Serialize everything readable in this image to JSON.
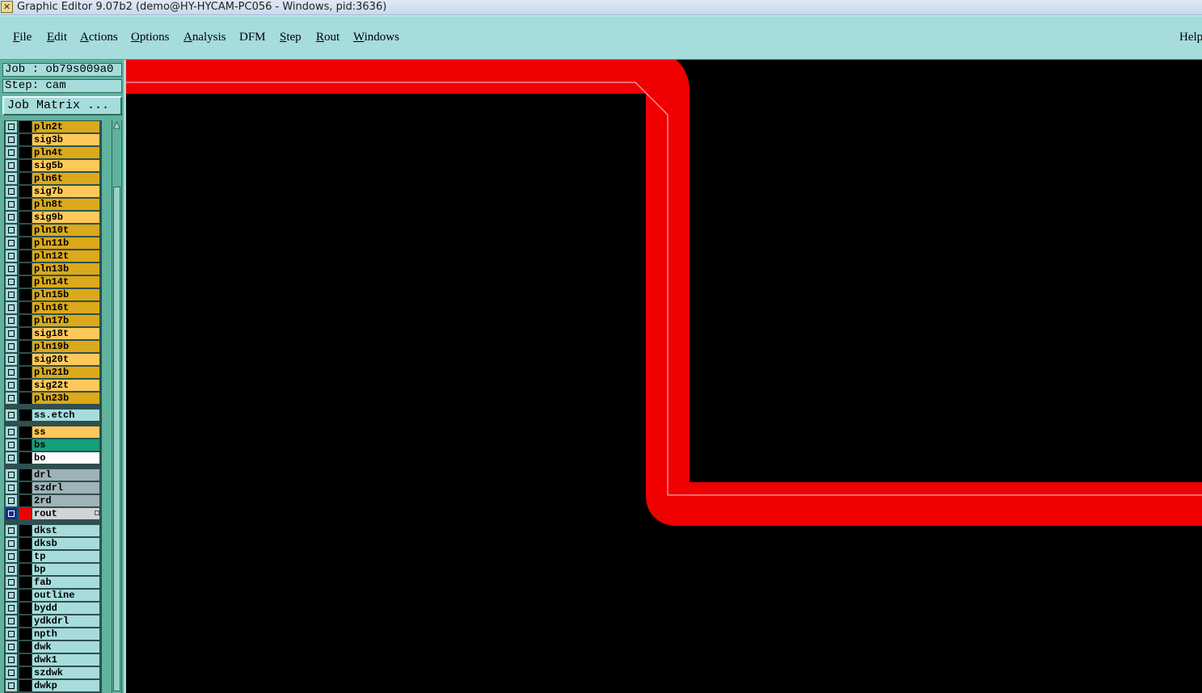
{
  "window": {
    "title": "Graphic Editor 9.07b2 (demo@HY-HYCAM-PC056 - Windows, pid:3636)"
  },
  "menu": {
    "file": {
      "mnemonic": "F",
      "rest": "ile"
    },
    "edit": {
      "mnemonic": "E",
      "rest": "dit"
    },
    "actions": {
      "mnemonic": "A",
      "rest": "ctions"
    },
    "options": {
      "mnemonic": "O",
      "rest": "ptions"
    },
    "analysis": {
      "mnemonic": "A",
      "rest": "nalysis"
    },
    "dfm": {
      "label": "DFM"
    },
    "step": {
      "mnemonic": "S",
      "rest": "tep"
    },
    "rout": {
      "mnemonic": "R",
      "rest": "out"
    },
    "windows": {
      "mnemonic": "W",
      "rest": "indows"
    },
    "help": {
      "label": "Help"
    }
  },
  "job": {
    "label": "Job : ob79s009a0"
  },
  "step": {
    "label": "Step: cam"
  },
  "job_matrix": {
    "label": "Job Matrix ..."
  },
  "layers": [
    {
      "name": "pln2t",
      "color": "#dba919"
    },
    {
      "name": "sig3b",
      "color": "#ffc85a"
    },
    {
      "name": "pln4t",
      "color": "#dba919"
    },
    {
      "name": "sig5b",
      "color": "#ffc85a"
    },
    {
      "name": "pln6t",
      "color": "#dba919"
    },
    {
      "name": "sig7b",
      "color": "#ffc85a"
    },
    {
      "name": "pln8t",
      "color": "#dba919"
    },
    {
      "name": "sig9b",
      "color": "#ffc85a"
    },
    {
      "name": "pln10t",
      "color": "#dba919"
    },
    {
      "name": "pln11b",
      "color": "#dba919"
    },
    {
      "name": "pln12t",
      "color": "#dba919"
    },
    {
      "name": "pln13b",
      "color": "#dba919"
    },
    {
      "name": "pln14t",
      "color": "#dba919"
    },
    {
      "name": "pln15b",
      "color": "#dba919"
    },
    {
      "name": "pln16t",
      "color": "#dba919"
    },
    {
      "name": "pln17b",
      "color": "#dba919"
    },
    {
      "name": "sig18t",
      "color": "#ffc85a"
    },
    {
      "name": "pln19b",
      "color": "#dba919"
    },
    {
      "name": "sig20t",
      "color": "#ffc85a"
    },
    {
      "name": "pln21b",
      "color": "#dba919"
    },
    {
      "name": "sig22t",
      "color": "#ffc85a"
    },
    {
      "name": "pln23b",
      "color": "#dba919"
    },
    {
      "name": "ss.etch",
      "color": "#a6dcdc"
    },
    {
      "name": "ss",
      "color": "#ffc85a"
    },
    {
      "name": "bs",
      "color": "#14a07a"
    },
    {
      "name": "bo",
      "color": "#ffffff"
    },
    {
      "name": "drl",
      "color": "#9fb2b8"
    },
    {
      "name": "szdrl",
      "color": "#9fb2b8"
    },
    {
      "name": "2rd",
      "color": "#9fb2b8"
    },
    {
      "name": "rout",
      "color": "#d0d5d4",
      "active": true
    },
    {
      "name": "dkst",
      "color": "#a6dcdc"
    },
    {
      "name": "dksb",
      "color": "#a6dcdc"
    },
    {
      "name": "tp",
      "color": "#a6dcdc"
    },
    {
      "name": "bp",
      "color": "#a6dcdc"
    },
    {
      "name": "fab",
      "color": "#a6dcdc"
    },
    {
      "name": "outline",
      "color": "#a6dcdc"
    },
    {
      "name": "bydd",
      "color": "#a6dcdc"
    },
    {
      "name": "ydkdrl",
      "color": "#a6dcdc"
    },
    {
      "name": "npth",
      "color": "#a6dcdc"
    },
    {
      "name": "dwk",
      "color": "#a6dcdc"
    },
    {
      "name": "dwk1",
      "color": "#a6dcdc"
    },
    {
      "name": "szdwk",
      "color": "#a6dcdc"
    },
    {
      "name": "dwkp",
      "color": "#a6dcdc"
    }
  ],
  "canvas": {
    "background": "#000000",
    "rout_color": "#f00000",
    "centerline_color": "#d8d8d8"
  }
}
